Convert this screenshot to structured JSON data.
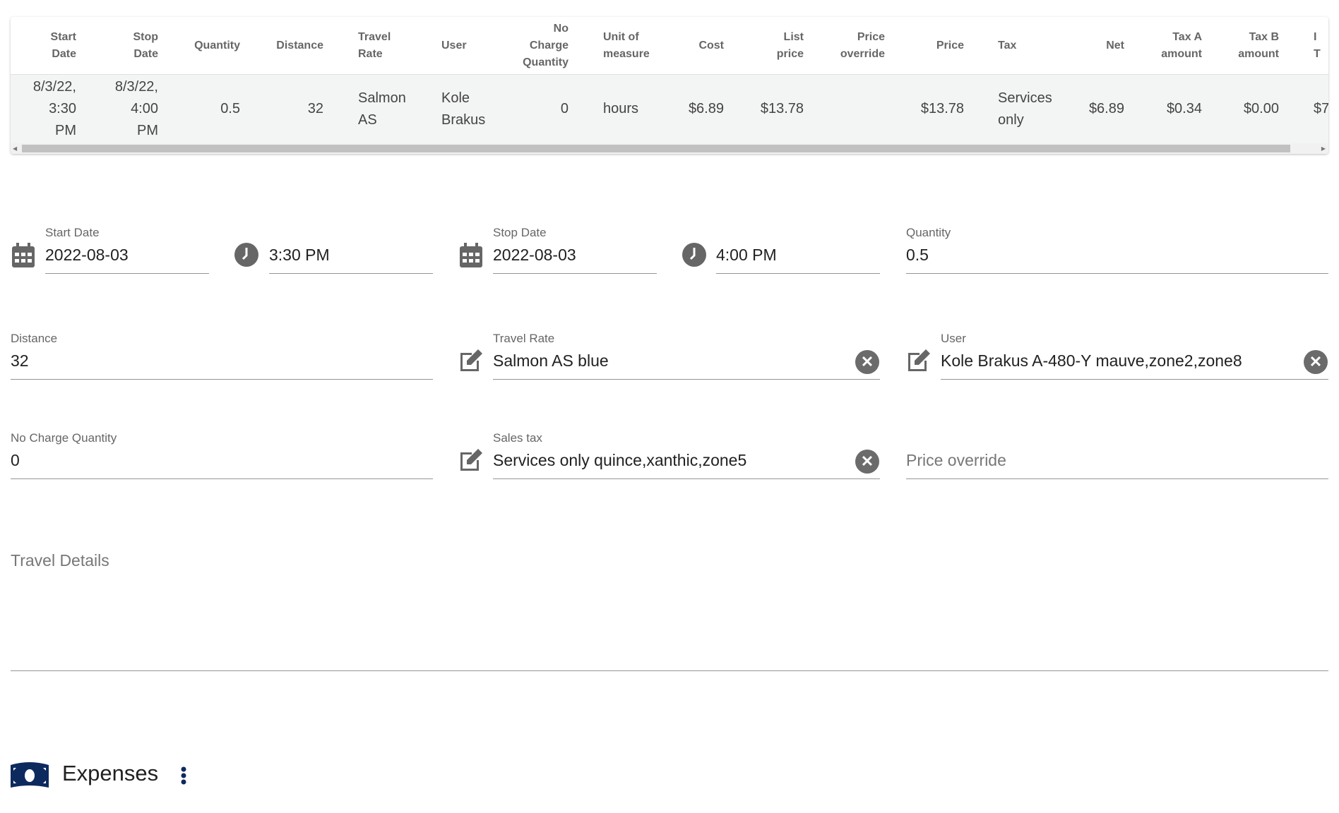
{
  "table": {
    "headers": [
      "Start\nDate",
      "Stop\nDate",
      "Quantity",
      "Distance",
      "Travel\nRate",
      "User",
      "No\nCharge\nQuantity",
      "Unit of\nmeasure",
      "Cost",
      "List\nprice",
      "Price\noverride",
      "Price",
      "Tax",
      "Net",
      "Tax A\namount",
      "Tax B\namount",
      "I\nT"
    ],
    "rows": [
      [
        "8/3/22,\n3:30\nPM",
        "8/3/22,\n4:00\nPM",
        "0.5",
        "32",
        "Salmon\nAS",
        "Kole\nBrakus",
        "0",
        "hours",
        "$6.89",
        "$13.78",
        "",
        "$13.78",
        "Services\nonly",
        "$6.89",
        "$0.34",
        "$0.00",
        "$7"
      ]
    ]
  },
  "form": {
    "start_date": {
      "label": "Start Date",
      "value": "2022-08-03"
    },
    "start_time": {
      "value": "3:30 PM"
    },
    "stop_date": {
      "label": "Stop Date",
      "value": "2022-08-03"
    },
    "stop_time": {
      "value": "4:00 PM"
    },
    "quantity": {
      "label": "Quantity",
      "value": "0.5"
    },
    "distance": {
      "label": "Distance",
      "value": "32"
    },
    "travel_rate": {
      "label": "Travel Rate",
      "value": "Salmon AS blue"
    },
    "user": {
      "label": "User",
      "value": "Kole Brakus A-480-Y mauve,zone2,zone8"
    },
    "no_charge_quantity": {
      "label": "No Charge Quantity",
      "value": "0"
    },
    "sales_tax": {
      "label": "Sales tax",
      "value": "Services only quince,xanthic,zone5"
    },
    "price_override": {
      "placeholder": "Price override"
    },
    "travel_details": {
      "placeholder": "Travel Details"
    }
  },
  "expenses": {
    "title": "Expenses",
    "icon": "money-bill-icon",
    "color": "#0d2a5e"
  },
  "icons": {
    "calendar": "calendar-icon",
    "clock": "clock-icon",
    "edit": "edit-icon",
    "clear": "clear-circle-icon",
    "menu": "more-vertical-icon"
  }
}
